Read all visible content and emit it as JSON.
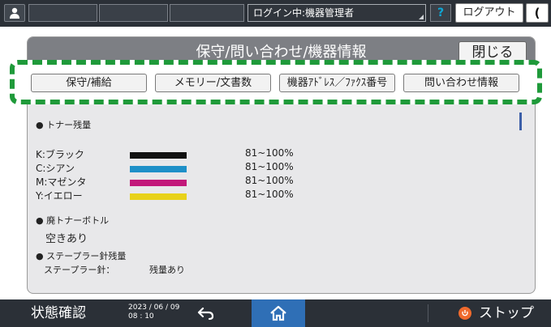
{
  "top_bar": {
    "login_status": "ログイン中:機器管理者",
    "help_label": "?",
    "logout_label": "ログアウト",
    "sleep_label": "("
  },
  "panel": {
    "title": "保守/問い合わせ/機器情報",
    "close_label": "閉じる"
  },
  "tabs": [
    {
      "label": "保守/補給"
    },
    {
      "label": "メモリー/文書数"
    },
    {
      "label": "機器ｱﾄﾞﾚｽ／ﾌｧｸｽ番号"
    },
    {
      "label": "問い合わせ情報"
    }
  ],
  "toner": {
    "heading": "● トナー残量",
    "rows": [
      {
        "label": "K:ブラック",
        "value": "81~100%",
        "color": "#111111",
        "level": 1.0
      },
      {
        "label": "C:シアン",
        "value": "81~100%",
        "color": "#1e90c8",
        "level": 1.0
      },
      {
        "label": "M:マゼンタ",
        "value": "81~100%",
        "color": "#c2187a",
        "level": 1.0
      },
      {
        "label": "Y:イエロー",
        "value": "81~100%",
        "color": "#e8d21a",
        "level": 1.0
      }
    ]
  },
  "waste_toner": {
    "heading": "● 廃トナーボトル",
    "value": "空きあり"
  },
  "staple": {
    "heading": "● ステープラー針残量",
    "partial_label": "ステープラー針：",
    "partial_value": "残量あり"
  },
  "bottom_bar": {
    "status_label": "状態確認",
    "date": "2023 / 06 / 09",
    "time": "08 : 10",
    "stop_label": "ストップ"
  },
  "icons": {
    "user": "user-icon",
    "back": "back-arrow-icon",
    "home": "home-icon",
    "stop": "stop-icon",
    "sleep": "moon-icon"
  }
}
